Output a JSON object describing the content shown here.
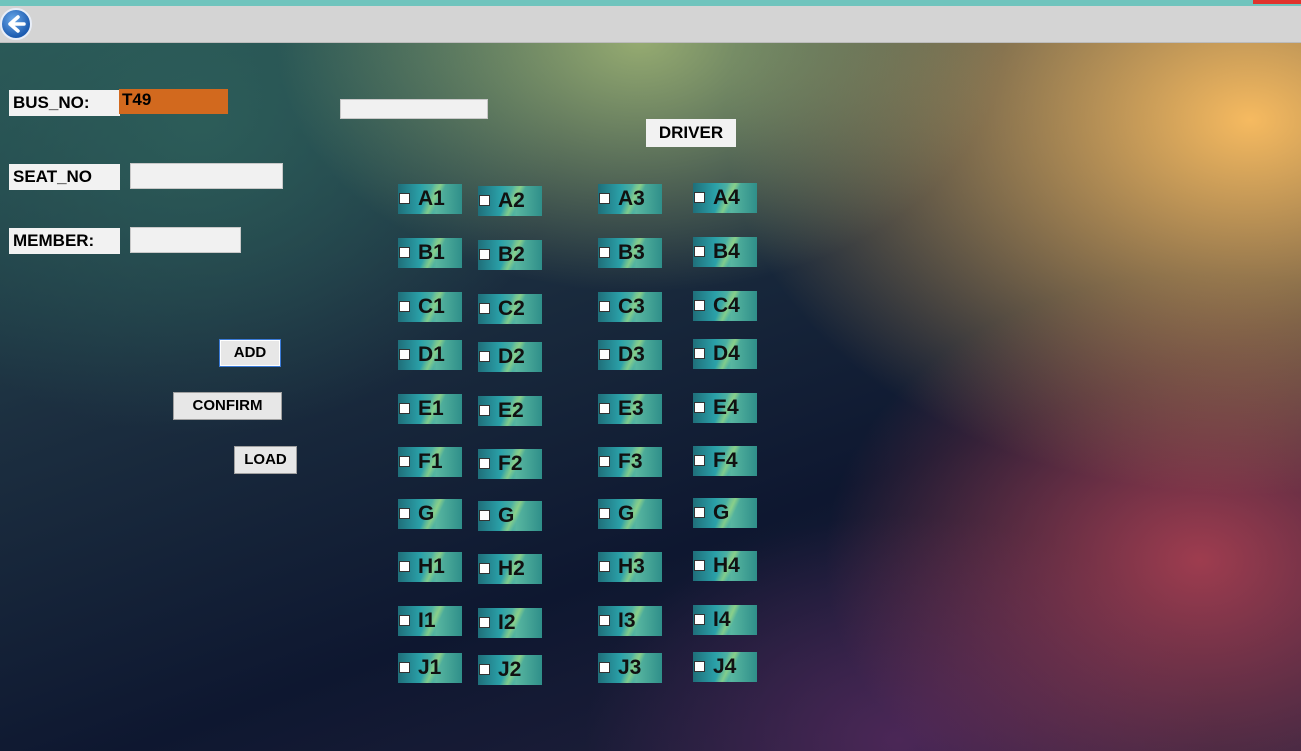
{
  "form": {
    "bus_no_label": "BUS_NO:",
    "bus_no_value": "T49",
    "seat_no_label": "SEAT_NO",
    "seat_no_value": "",
    "member_label": "MEMBER:",
    "member_value": "",
    "top_field_value": ""
  },
  "buttons": {
    "add": "ADD",
    "confirm": "CONFIRM",
    "load": "LOAD"
  },
  "driver_label": "DRIVER",
  "seats": [
    [
      "A1",
      "A2",
      "A3",
      "A4"
    ],
    [
      "B1",
      "B2",
      "B3",
      "B4"
    ],
    [
      "C1",
      "C2",
      "C3",
      "C4"
    ],
    [
      "D1",
      "D2",
      "D3",
      "D4"
    ],
    [
      "E1",
      "E2",
      "E3",
      "E4"
    ],
    [
      "F1",
      "F2",
      "F3",
      "F4"
    ],
    [
      "G",
      "G",
      "G",
      "G"
    ],
    [
      "H1",
      "H2",
      "H3",
      "H4"
    ],
    [
      "I1",
      "I2",
      "I3",
      "I4"
    ],
    [
      "J1",
      "J2",
      "J3",
      "J4"
    ]
  ],
  "icons": {
    "back": "back-arrow-icon"
  },
  "colors": {
    "bus_no_field": "#d2691e",
    "toolbar": "#d4d4d4",
    "top_accent": "#6fc4bd"
  }
}
